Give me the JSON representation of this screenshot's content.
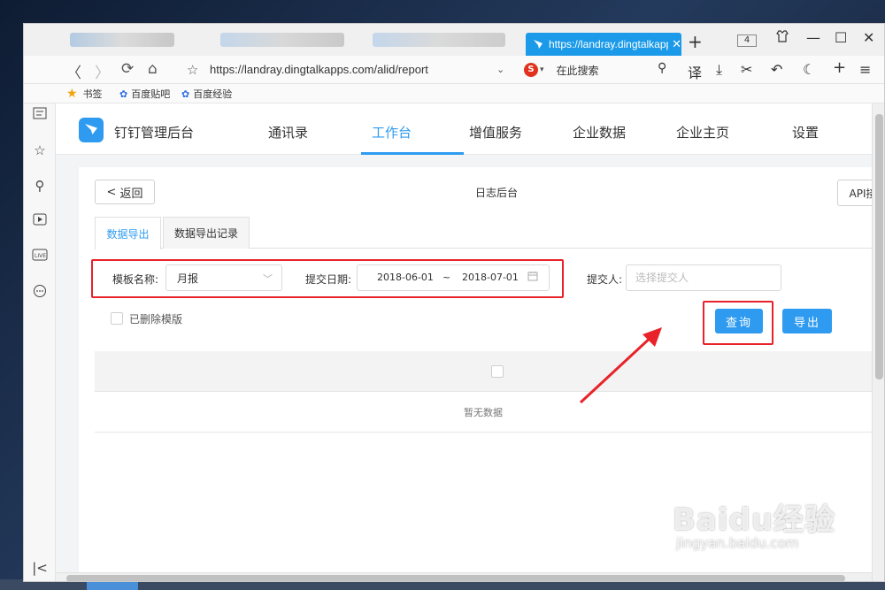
{
  "browser": {
    "active_tab_title": "https://landray.dingtalkapps.com/alid/report",
    "tab_count": "4",
    "url": "https://landray.dingtalkapps.com/alid/report",
    "search_placeholder": "在此搜索",
    "toolbar_translate": "译",
    "bookmarks": [
      {
        "label": "书签"
      },
      {
        "label": "百度贴吧"
      },
      {
        "label": "百度经验"
      }
    ]
  },
  "app": {
    "brand": "钉钉管理后台",
    "nav": [
      "通讯录",
      "工作台",
      "增值服务",
      "企业数据",
      "企业主页",
      "设置"
    ],
    "active_nav": "工作台",
    "back_label": "返回",
    "page_title": "日志后台",
    "api_label": "API接入",
    "subtabs": [
      "数据导出",
      "数据导出记录"
    ],
    "filters": {
      "template_label": "模板名称:",
      "template_value": "月报",
      "date_label": "提交日期:",
      "date_start": "2018-06-01",
      "date_sep": "~",
      "date_end": "2018-07-01",
      "submitter_label": "提交人:",
      "submitter_placeholder": "选择提交人",
      "deleted_template_label": "已删除模版"
    },
    "query_label": "查询",
    "export_label": "导出",
    "empty_text": "暂无数据"
  },
  "watermark": {
    "top": "Baidu经验",
    "bottom": "jingyan.baidu.com"
  },
  "colors": {
    "accent": "#2e9bf0",
    "highlight": "#e8232a",
    "tab_active": "#1a9ae8"
  }
}
